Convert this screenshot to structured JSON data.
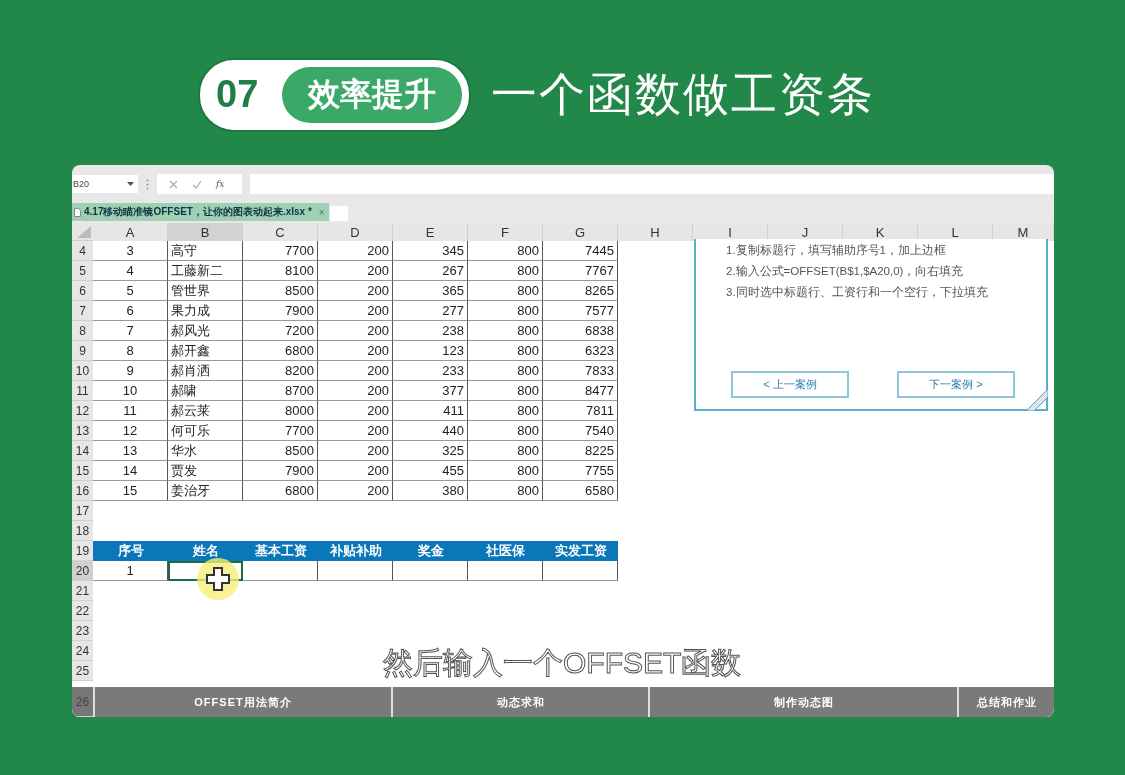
{
  "header": {
    "number": "07",
    "badge": "效率提升",
    "title": "一个函数做工资条"
  },
  "formula_bar": {
    "name_box": "B20",
    "fx": "fx"
  },
  "workbook_tab": {
    "title": "4.17移动瞄准镜OFFSET，让你的图表动起来.xlsx *",
    "close": "×"
  },
  "columns": [
    {
      "label": "A",
      "selected": false
    },
    {
      "label": "B",
      "selected": true
    },
    {
      "label": "C",
      "selected": false
    },
    {
      "label": "D",
      "selected": false
    },
    {
      "label": "E",
      "selected": false
    },
    {
      "label": "F",
      "selected": false
    },
    {
      "label": "G",
      "selected": false
    },
    {
      "label": "H",
      "selected": false
    },
    {
      "label": "I",
      "selected": false
    },
    {
      "label": "J",
      "selected": false
    },
    {
      "label": "K",
      "selected": false
    },
    {
      "label": "L",
      "selected": false
    },
    {
      "label": "M",
      "selected": false
    }
  ],
  "rows": [
    {
      "number": "4",
      "cells": [
        "3",
        "高守",
        "7700",
        "200",
        "345",
        "800",
        "7445"
      ]
    },
    {
      "number": "5",
      "cells": [
        "4",
        "工藤新二",
        "8100",
        "200",
        "267",
        "800",
        "7767"
      ]
    },
    {
      "number": "6",
      "cells": [
        "5",
        "管世界",
        "8500",
        "200",
        "365",
        "800",
        "8265"
      ]
    },
    {
      "number": "7",
      "cells": [
        "6",
        "果力成",
        "7900",
        "200",
        "277",
        "800",
        "7577"
      ]
    },
    {
      "number": "8",
      "cells": [
        "7",
        "郝风光",
        "7200",
        "200",
        "238",
        "800",
        "6838"
      ]
    },
    {
      "number": "9",
      "cells": [
        "8",
        "郝开鑫",
        "6800",
        "200",
        "123",
        "800",
        "6323"
      ]
    },
    {
      "number": "10",
      "cells": [
        "9",
        "郝肖洒",
        "8200",
        "200",
        "233",
        "800",
        "7833"
      ]
    },
    {
      "number": "11",
      "cells": [
        "10",
        "郝啸",
        "8700",
        "200",
        "377",
        "800",
        "8477"
      ]
    },
    {
      "number": "12",
      "cells": [
        "11",
        "郝云莱",
        "8000",
        "200",
        "411",
        "800",
        "7811"
      ]
    },
    {
      "number": "13",
      "cells": [
        "12",
        "何可乐",
        "7700",
        "200",
        "440",
        "800",
        "7540"
      ]
    },
    {
      "number": "14",
      "cells": [
        "13",
        "华水",
        "8500",
        "200",
        "325",
        "800",
        "8225"
      ]
    },
    {
      "number": "15",
      "cells": [
        "14",
        "贾发",
        "7900",
        "200",
        "455",
        "800",
        "7755"
      ]
    },
    {
      "number": "16",
      "cells": [
        "15",
        "姜治牙",
        "6800",
        "200",
        "380",
        "800",
        "6580"
      ]
    }
  ],
  "blank_rows_before": [
    "17",
    "18"
  ],
  "salary_header": {
    "number": "19",
    "cells": [
      "序号",
      "姓名",
      "基本工资",
      "补贴补助",
      "奖金",
      "社医保",
      "实发工资"
    ]
  },
  "input_row": {
    "number": "20",
    "selected": true,
    "cells": [
      {
        "text": "1",
        "selected": false
      },
      {
        "selected": true
      },
      {
        "selected": false
      },
      {
        "selected": false
      },
      {
        "selected": false
      },
      {
        "selected": false
      },
      {
        "selected": false
      }
    ]
  },
  "blank_rows_after": [
    "21",
    "22",
    "23",
    "24",
    "25"
  ],
  "instructions": {
    "lines": [
      "1.复制标题行，填写辅助序号1，加上边框",
      "2.输入公式=OFFSET(B$1,$A20,0)，向右填充",
      "3.同时选中标题行、工资行和一个空行，下拉填充"
    ],
    "buttons": [
      "< 上一案例",
      "下一案例 >"
    ]
  },
  "subtitle": "然后输入一个OFFSET函数",
  "nav": {
    "number": "26",
    "items": [
      "OFFSET用法简介",
      "动态求和",
      "制作动态图",
      "总结和作业"
    ]
  }
}
